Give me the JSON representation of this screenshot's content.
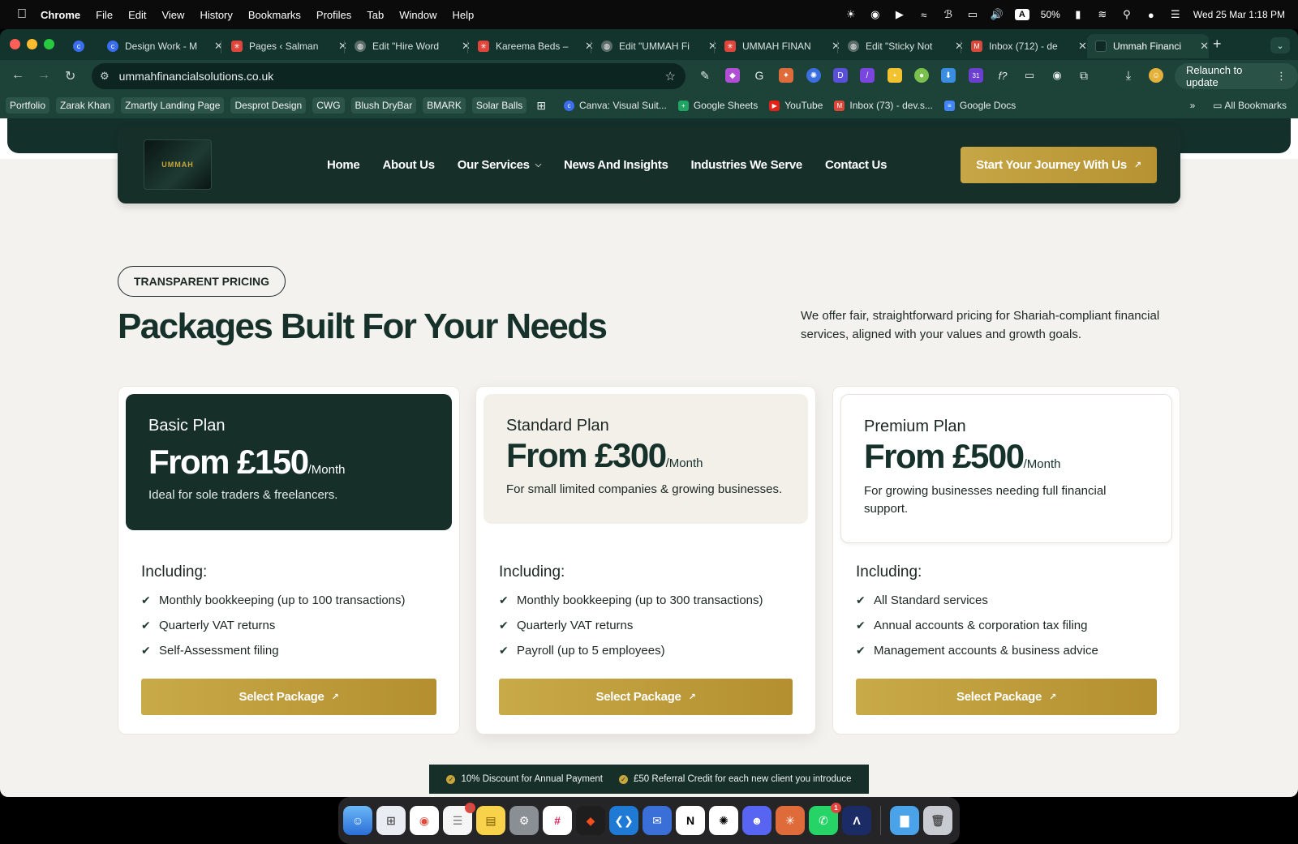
{
  "menubar": {
    "app": "Chrome",
    "items": [
      "File",
      "Edit",
      "View",
      "History",
      "Bookmarks",
      "Profiles",
      "Tab",
      "Window",
      "Help"
    ],
    "battery": "50%",
    "input_source": "A",
    "datetime": "Wed 25 Mar  1:18 PM"
  },
  "tabs": [
    {
      "label": "Design Work - M",
      "favicon": "canva-icon",
      "color": "#3a6df0"
    },
    {
      "label": "Pages ‹ Salman",
      "favicon": "asterisk-icon",
      "color": "#e0453b"
    },
    {
      "label": "Edit \"Hire Word",
      "favicon": "globe-icon",
      "color": "#5b6d68"
    },
    {
      "label": "Kareema Beds –",
      "favicon": "asterisk-icon",
      "color": "#e0453b"
    },
    {
      "label": "Edit \"UMMAH Fi",
      "favicon": "globe-icon",
      "color": "#5b6d68"
    },
    {
      "label": "UMMAH FINAN",
      "favicon": "asterisk-icon",
      "color": "#e0453b"
    },
    {
      "label": "Edit \"Sticky Not",
      "favicon": "globe-icon",
      "color": "#5b6d68"
    },
    {
      "label": "Inbox (712) - de",
      "favicon": "gmail-icon",
      "color": "#d8483b"
    },
    {
      "label": "Ummah Financi",
      "favicon": "ummah-icon",
      "color": "#0f2a24"
    }
  ],
  "toolbar": {
    "url": "ummahfinancialsolutions.co.uk",
    "relaunch": "Relaunch to update",
    "calendar_badge": "31"
  },
  "bookmarks": {
    "chips": [
      "Portfolio",
      "Zarak Khan",
      "Zmartly Landing Page",
      "Desprot Design",
      "CWG",
      "Blush DryBar",
      "BMARK",
      "Solar Balls"
    ],
    "links": [
      {
        "label": "Canva: Visual Suit...",
        "color": "#3a6df0"
      },
      {
        "label": "Google Sheets",
        "color": "#1fa463"
      },
      {
        "label": "YouTube",
        "color": "#e62117"
      },
      {
        "label": "Inbox (73) - dev.s...",
        "color": "#d8483b"
      },
      {
        "label": "Google Docs",
        "color": "#4285f4"
      }
    ],
    "all": "All Bookmarks"
  },
  "site": {
    "logo": "UMMAH",
    "nav": [
      "Home",
      "About Us",
      "Our Services",
      "News And Insights",
      "Industries We Serve",
      "Contact Us"
    ],
    "cta": "Start Your Journey With Us"
  },
  "pricing": {
    "eyebrow": "TRANSPARENT PRICING",
    "heading": "Packages Built For Your Needs",
    "intro": "We offer fair, straightforward pricing for Shariah-compliant financial services, aligned with your values and growth goals.",
    "including_label": "Including:",
    "select_label": "Select Package",
    "plans": [
      {
        "name": "Basic Plan",
        "price": "From £150",
        "per": "/Month",
        "desc": "Ideal for sole traders & freelancers.",
        "features": [
          "Monthly bookkeeping (up to 100 transactions)",
          "Quarterly VAT returns",
          "Self-Assessment filing"
        ]
      },
      {
        "name": "Standard Plan",
        "price": "From £300",
        "per": "/Month",
        "desc": "For small limited companies & growing businesses.",
        "features": [
          "Monthly bookkeeping (up to 300 transactions)",
          "Quarterly VAT returns",
          "Payroll (up to 5 employees)"
        ]
      },
      {
        "name": "Premium Plan",
        "price": "From £500",
        "per": "/Month",
        "desc": "For growing businesses needing full financial support.",
        "features": [
          "All Standard services",
          "Annual accounts & corporation tax filing",
          "Management accounts & business advice"
        ]
      }
    ],
    "promo": [
      "10% Discount for Annual Payment",
      "£50 Referral Credit for each new client you introduce"
    ]
  },
  "colors": {
    "brand_dark": "#163029",
    "gold": "#c6a646",
    "page_bg": "#f4f2ee"
  },
  "dock_badges": {
    "reminders": "1",
    "whatsapp": "1"
  }
}
